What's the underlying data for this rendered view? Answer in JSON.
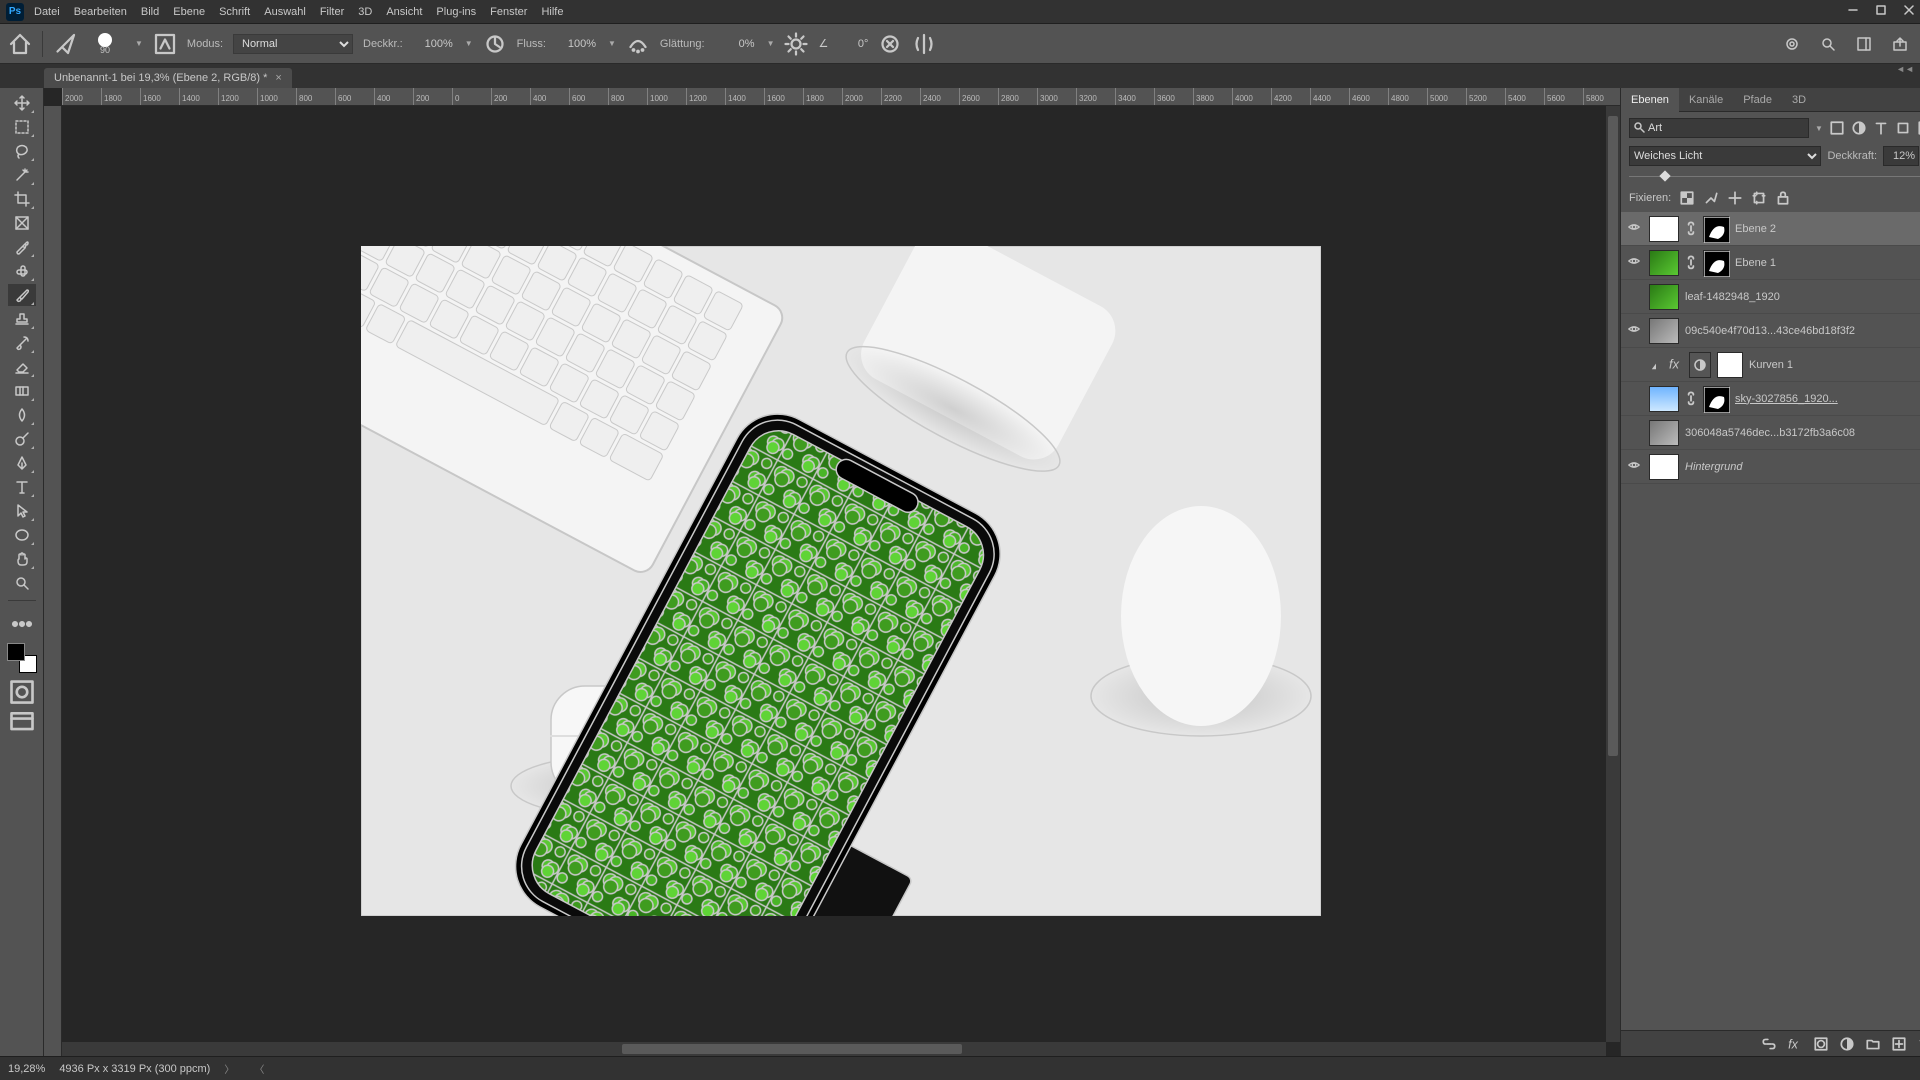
{
  "menu": [
    "Datei",
    "Bearbeiten",
    "Bild",
    "Ebene",
    "Schrift",
    "Auswahl",
    "Filter",
    "3D",
    "Ansicht",
    "Plug-ins",
    "Fenster",
    "Hilfe"
  ],
  "options": {
    "brush_size": "90",
    "mode_label": "Modus:",
    "mode_value": "Normal",
    "opacity_label": "Deckkr.:",
    "opacity_value": "100%",
    "flow_label": "Fluss:",
    "flow_value": "100%",
    "smoothing_label": "Glättung:",
    "smoothing_value": "0%",
    "angle_icon": "∠",
    "angle_value": "0°"
  },
  "document": {
    "tab_title": "Unbenannt-1 bei 19,3% (Ebene 2, RGB/8) *"
  },
  "ruler_ticks": [
    "2000",
    "1800",
    "1600",
    "1400",
    "1200",
    "1000",
    "800",
    "600",
    "400",
    "200",
    "0",
    "200",
    "400",
    "600",
    "800",
    "1000",
    "1200",
    "1400",
    "1600",
    "1800",
    "2000",
    "2200",
    "2400",
    "2600",
    "2800",
    "3000",
    "3200",
    "3400",
    "3600",
    "3800",
    "4000",
    "4200",
    "4400",
    "4600",
    "4800",
    "5000",
    "5200",
    "5400",
    "5600",
    "5800"
  ],
  "panels": {
    "tabs": [
      "Ebenen",
      "Kanäle",
      "Pfade",
      "3D"
    ],
    "search_placeholder": "Art",
    "blend_mode": "Weiches Licht",
    "opacity_label": "Deckkraft:",
    "opacity_value": "12%",
    "lock_label": "Fixieren:"
  },
  "layers": [
    {
      "visible": true,
      "name": "Ebene 2",
      "selected": true,
      "mask": true,
      "thumb": "white",
      "italic": false,
      "strike": false,
      "link": true
    },
    {
      "visible": true,
      "name": "Ebene 1",
      "selected": false,
      "mask": true,
      "thumb": "green",
      "italic": false,
      "strike": false,
      "link": true
    },
    {
      "visible": false,
      "name": "leaf-1482948_1920",
      "selected": false,
      "mask": false,
      "thumb": "green",
      "italic": false,
      "strike": false
    },
    {
      "visible": true,
      "name": "09c540e4f70d13...43ce46bd18f3f2",
      "selected": false,
      "mask": false,
      "thumb": "gray",
      "italic": false,
      "strike": false
    },
    {
      "visible": false,
      "name": "Kurven 1",
      "selected": false,
      "mask": false,
      "thumb": "white",
      "italic": false,
      "strike": false,
      "adjust": true,
      "clip": true
    },
    {
      "visible": false,
      "name": "sky-3027856_1920...",
      "selected": false,
      "mask": true,
      "thumb": "sky",
      "italic": false,
      "strike": true,
      "link": true
    },
    {
      "visible": false,
      "name": "306048a5746dec...b3172fb3a6c08",
      "selected": false,
      "mask": false,
      "thumb": "gray",
      "italic": false,
      "strike": false
    },
    {
      "visible": true,
      "name": "Hintergrund",
      "selected": false,
      "mask": false,
      "thumb": "white",
      "italic": true,
      "strike": false,
      "locked": true
    }
  ],
  "status": {
    "zoom": "19,28%",
    "dims": "4936 Px x 3319 Px (300 ppcm)"
  }
}
